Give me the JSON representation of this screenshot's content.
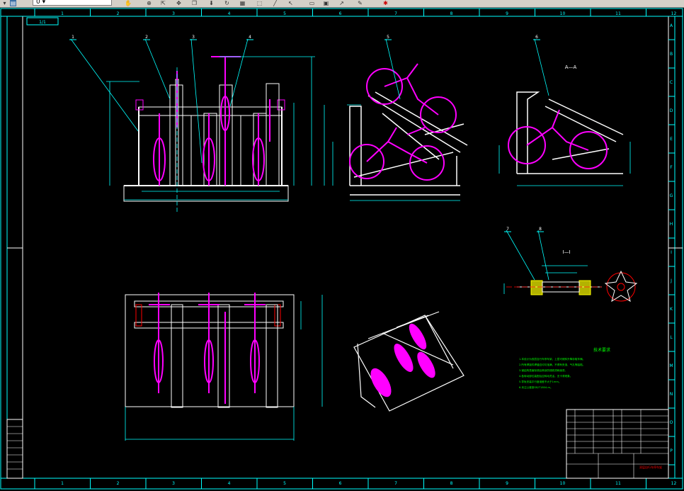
{
  "toolbar": {
    "layer_combo_value": "0 ▾",
    "icons": [
      "pan-icon",
      "zoom-icon",
      "undo-icon",
      "redo-icon",
      "refresh-icon",
      "window-icon",
      "arrow-icon",
      "copy-icon",
      "layer-icon",
      "settings-icon"
    ]
  },
  "drawing": {
    "top_ruler": [
      "1",
      "2",
      "3",
      "4",
      "5",
      "6",
      "7",
      "8",
      "9",
      "10",
      "11",
      "12"
    ],
    "side_ruler": [
      "A",
      "B",
      "C",
      "D",
      "E",
      "F",
      "G",
      "H",
      "I",
      "J",
      "K",
      "L",
      "M",
      "N",
      "O",
      "P"
    ],
    "corner_tag": "1/1",
    "balloons": [
      "1",
      "2",
      "3",
      "4",
      "5",
      "6",
      "7",
      "8"
    ],
    "section_mark": "A—A",
    "detail_mark": "I—I",
    "tech_title": "技术要求",
    "tech_notes": [
      "1.本设计为双层自行车停车架，上层可倾斜升降存取车辆。",
      "2.所有焊接件焊缝应均匀饱满，不得有夹渣、气孔等缺陷。",
      "3.钢结构表面除锈后喷涂防锈底漆和面漆。",
      "4.各转动部位装配后应转动灵活，无卡滞现象。",
      "5.导轨安装平行度误差不大于1mm。",
      "6.未注公差按GB/T1804-m。"
    ],
    "title_block_name": "双层自行车停车架",
    "colors": {
      "frame": "#00ffff",
      "line": "#ffffff",
      "bike": "#ff00ff",
      "hatch": "#ffff00",
      "dim": "#00ff00",
      "section": "#ff0000"
    }
  }
}
